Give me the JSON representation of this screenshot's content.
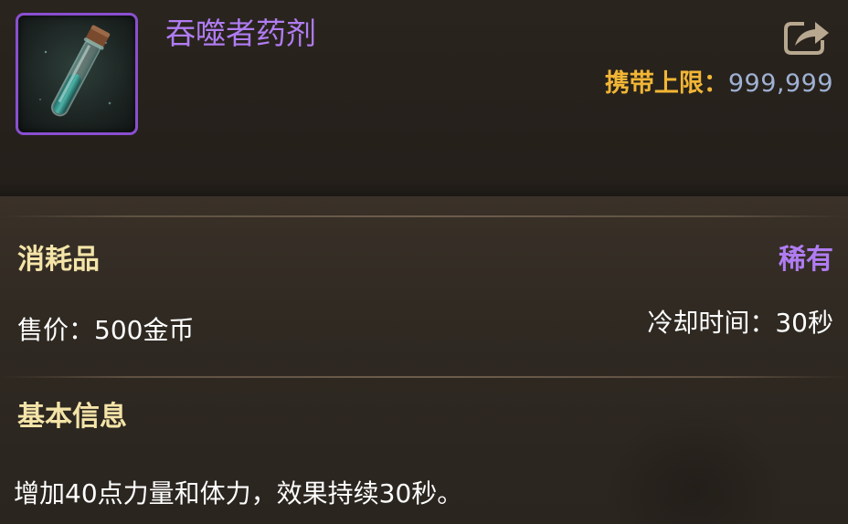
{
  "item": {
    "name": "吞噬者药剂",
    "icon": "potion-vial-icon",
    "rarity_color": "#b07cf2"
  },
  "carry": {
    "label": "携带上限",
    "separator": "：",
    "value": "999,999"
  },
  "share": {
    "icon": "share-export-icon"
  },
  "info": {
    "category": "消耗品",
    "rarity": "稀有",
    "price": "售价：500金币",
    "cooldown": "冷却时间：30秒"
  },
  "section": {
    "title": "基本信息",
    "description": "增加40点力量和体力，效果持续30秒。"
  },
  "colors": {
    "gold": "#f2b636",
    "cream": "#f4e4a8",
    "value_blue": "#9fb1d4",
    "panel": "#2b2620"
  }
}
